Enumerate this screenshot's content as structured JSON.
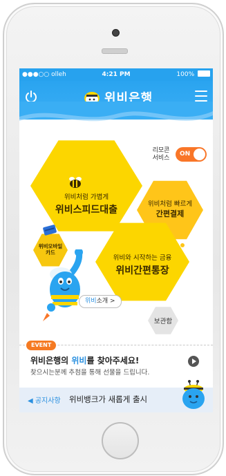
{
  "status_bar": {
    "carrier": "●●●○○ olleh",
    "time": "4:21 PM",
    "battery": "100%"
  },
  "header": {
    "title": "위비은행",
    "brand_color": "#2aa4f0"
  },
  "remote": {
    "label_line1": "리모콘",
    "label_line2": "서비스",
    "toggle_state": "ON",
    "toggle_color": "#f97628"
  },
  "tiles": {
    "speed_loan": {
      "subtitle": "위비처럼 가볍게",
      "title": "위비스피드대출"
    },
    "quick_pay": {
      "subtitle": "위비처럼 빠르게",
      "title": "간편결제"
    },
    "account": {
      "subtitle": "위비와 시작하는 금융",
      "title": "위비간편통장"
    },
    "mobile_card": {
      "line1": "위비모바일",
      "line2": "카드"
    },
    "storage": {
      "label": "보관함"
    }
  },
  "bee_intro": {
    "highlight": "위비",
    "rest": "소개",
    "arrow": ">"
  },
  "event": {
    "badge": "EVENT",
    "title_pre": "위비은행의 ",
    "title_highlight": "위비",
    "title_post": "를 찾아주세요!",
    "description": "찾으시는분께 추첨을 통해 선물을 드립니다."
  },
  "notice": {
    "label": "◀ 공지사항",
    "text": "위비뱅크가 새롭게 출시"
  }
}
